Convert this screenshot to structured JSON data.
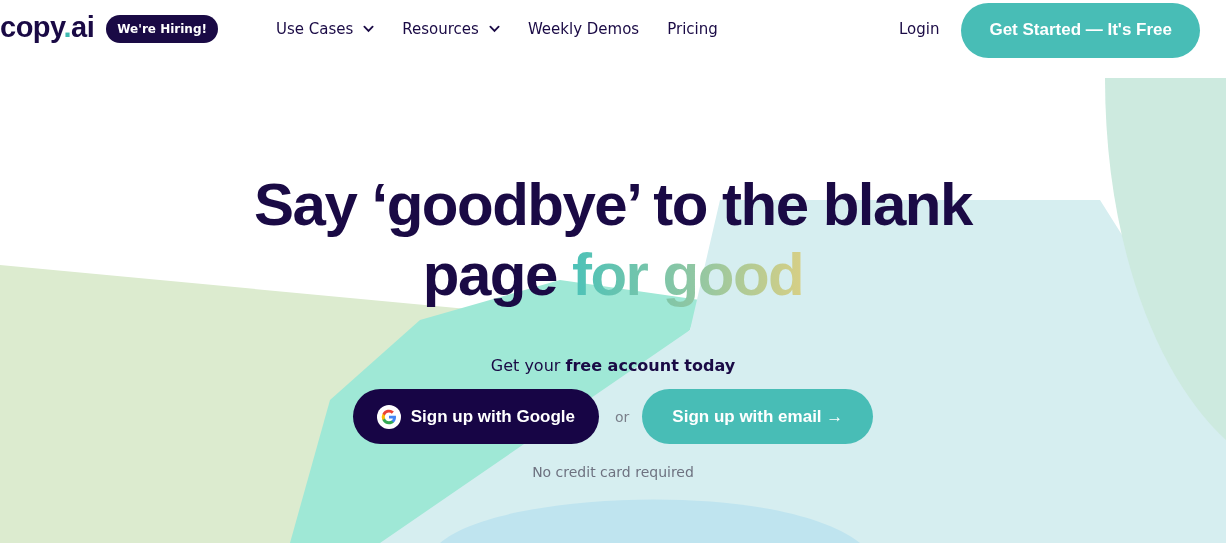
{
  "logo": {
    "name": "copy",
    "dot": ".",
    "suffix": "ai"
  },
  "hiring_badge": "We're Hiring!",
  "nav": [
    {
      "label": "Use Cases",
      "has_menu": true
    },
    {
      "label": "Resources",
      "has_menu": true
    },
    {
      "label": "Weekly Demos",
      "has_menu": false
    },
    {
      "label": "Pricing",
      "has_menu": false
    }
  ],
  "login": "Login",
  "cta": "Get Started — It's Free",
  "hero": {
    "line_1": "Say ‘goodbye’ to the blank",
    "line_2": "page",
    "highlight": "for good",
    "subtitle": "Get your **free account today**",
    "google_button": "Sign up with Google",
    "or": "or",
    "email_button": "Sign up with email →",
    "note": "No credit card required"
  }
}
